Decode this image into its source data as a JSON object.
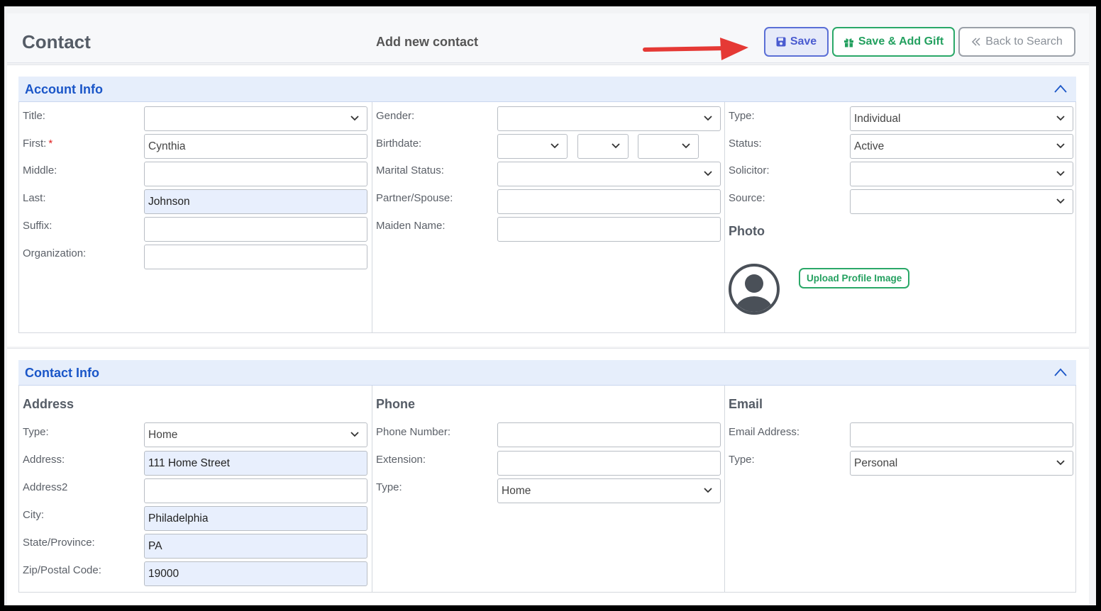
{
  "header": {
    "title": "Contact",
    "subtitle": "Add new contact",
    "save_label": "Save",
    "save_gift_label": "Save & Add Gift",
    "back_label": "Back to Search"
  },
  "account_info": {
    "title": "Account Info",
    "title_label": "Title:",
    "title_value": "",
    "first_label": "First:",
    "first_required": "*",
    "first_value": "Cynthia",
    "middle_label": "Middle:",
    "middle_value": "",
    "last_label": "Last:",
    "last_value": "Johnson",
    "suffix_label": "Suffix:",
    "suffix_value": "",
    "organization_label": "Organization:",
    "organization_value": "",
    "gender_label": "Gender:",
    "gender_value": "",
    "birthdate_label": "Birthdate:",
    "marital_label": "Marital Status:",
    "marital_value": "",
    "partner_label": "Partner/Spouse:",
    "partner_value": "",
    "maiden_label": "Maiden Name:",
    "maiden_value": "",
    "type_label": "Type:",
    "type_value": "Individual",
    "status_label": "Status:",
    "status_value": "Active",
    "solicitor_label": "Solicitor:",
    "solicitor_value": "",
    "source_label": "Source:",
    "source_value": "",
    "photo_label": "Photo",
    "upload_label": "Upload Profile Image"
  },
  "contact_info": {
    "title": "Contact Info",
    "address": {
      "heading": "Address",
      "type_label": "Type:",
      "type_value": "Home",
      "address_label": "Address:",
      "address_value": "111 Home Street",
      "address2_label": "Address2",
      "address2_value": "",
      "city_label": "City:",
      "city_value": "Philadelphia",
      "state_label": "State/Province:",
      "state_value": "PA",
      "zip_label": "Zip/Postal Code:",
      "zip_value": "19000"
    },
    "phone": {
      "heading": "Phone",
      "number_label": "Phone Number:",
      "number_value": "",
      "extension_label": "Extension:",
      "extension_value": "",
      "type_label": "Type:",
      "type_value": "Home"
    },
    "email": {
      "heading": "Email",
      "address_label": "Email Address:",
      "address_value": "",
      "type_label": "Type:",
      "type_value": "Personal"
    }
  },
  "colors": {
    "accent_blue": "#1a56c8",
    "save_border": "#5b6fd6",
    "gift_green": "#2aa868",
    "arrow_red": "#e53935",
    "filled_field": "#e8effd"
  },
  "icons": [
    "save-icon",
    "gift-icon",
    "double-chevron-left-icon",
    "chevron-up-icon",
    "chevron-down-icon",
    "user-avatar-icon"
  ]
}
